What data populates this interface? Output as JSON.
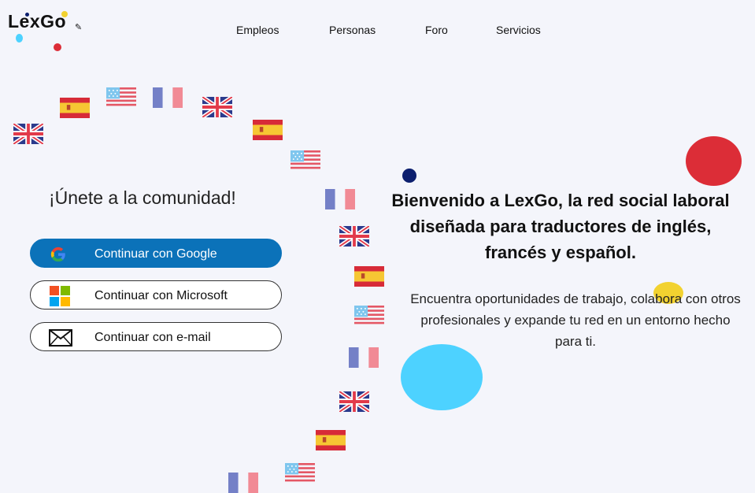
{
  "brand": {
    "name": "LexGo"
  },
  "nav": {
    "items": [
      "Empleos",
      "Personas",
      "Foro",
      "Servicios"
    ]
  },
  "auth": {
    "title": "¡Únete a la comunidad!",
    "buttons": {
      "google": "Continuar con Google",
      "microsoft": "Continuar con Microsoft",
      "email": "Continuar con e-mail"
    }
  },
  "hero": {
    "headline": "Bienvenido a LexGo, la red social laboral diseñada para traductores de inglés, francés y español.",
    "description": "Encuentra oportunidades de trabajo, colabora con otros profesionales y expande tu red en un entorno hecho para ti."
  },
  "colors": {
    "primary": "#0b72b9",
    "red_accent": "#dc2d37",
    "cyan_accent": "#4dd2ff",
    "yellow_accent": "#f2d230",
    "navy_accent": "#0c1f6e"
  },
  "icons": [
    "google-icon",
    "microsoft-icon",
    "mail-icon"
  ]
}
